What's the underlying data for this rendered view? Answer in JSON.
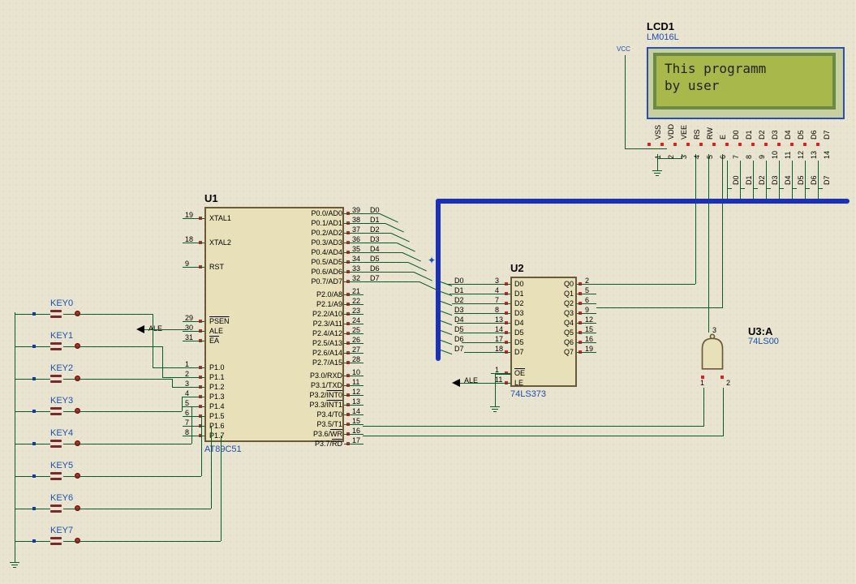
{
  "components": {
    "u1": {
      "ref": "U1",
      "part": "AT89C51",
      "pins_left": [
        {
          "name": "XTAL1",
          "num": "19"
        },
        {
          "name": "XTAL2",
          "num": "18"
        },
        {
          "name": "RST",
          "num": "9"
        },
        {
          "name": "PSEN",
          "num": "29",
          "over": true
        },
        {
          "name": "ALE",
          "num": "30"
        },
        {
          "name": "EA",
          "num": "31",
          "over": true
        },
        {
          "name": "P1.0",
          "num": "1"
        },
        {
          "name": "P1.1",
          "num": "2"
        },
        {
          "name": "P1.2",
          "num": "3"
        },
        {
          "name": "P1.3",
          "num": "4"
        },
        {
          "name": "P1.4",
          "num": "5"
        },
        {
          "name": "P1.5",
          "num": "6"
        },
        {
          "name": "P1.6",
          "num": "7"
        },
        {
          "name": "P1.7",
          "num": "8"
        }
      ],
      "pins_right": [
        {
          "name": "P0.0/AD0",
          "num": "39",
          "net": "D0"
        },
        {
          "name": "P0.1/AD1",
          "num": "38",
          "net": "D1"
        },
        {
          "name": "P0.2/AD2",
          "num": "37",
          "net": "D2"
        },
        {
          "name": "P0.3/AD3",
          "num": "36",
          "net": "D3"
        },
        {
          "name": "P0.4/AD4",
          "num": "35",
          "net": "D4"
        },
        {
          "name": "P0.5/AD5",
          "num": "34",
          "net": "D5"
        },
        {
          "name": "P0.6/AD6",
          "num": "33",
          "net": "D6"
        },
        {
          "name": "P0.7/AD7",
          "num": "32",
          "net": "D7"
        },
        {
          "name": "P2.0/A8",
          "num": "21"
        },
        {
          "name": "P2.1/A9",
          "num": "22"
        },
        {
          "name": "P2.2/A10",
          "num": "23"
        },
        {
          "name": "P2.3/A11",
          "num": "24"
        },
        {
          "name": "P2.4/A12",
          "num": "25"
        },
        {
          "name": "P2.5/A13",
          "num": "26"
        },
        {
          "name": "P2.6/A14",
          "num": "27"
        },
        {
          "name": "P2.7/A15",
          "num": "28"
        },
        {
          "name": "P3.0/RXD",
          "num": "10"
        },
        {
          "name": "P3.1/TXD",
          "num": "11"
        },
        {
          "name": "P3.2/INT0",
          "num": "12",
          "over": "INT0"
        },
        {
          "name": "P3.3/INT1",
          "num": "13",
          "over": "INT1"
        },
        {
          "name": "P3.4/T0",
          "num": "14"
        },
        {
          "name": "P3.5/T1",
          "num": "15"
        },
        {
          "name": "P3.6/WR",
          "num": "16",
          "over": "WR"
        },
        {
          "name": "P3.7/RD",
          "num": "17",
          "over": "RD"
        }
      ]
    },
    "u2": {
      "ref": "U2",
      "part": "74LS373",
      "pins_left": [
        {
          "name": "D0",
          "num": "3"
        },
        {
          "name": "D1",
          "num": "4"
        },
        {
          "name": "D2",
          "num": "7"
        },
        {
          "name": "D3",
          "num": "8"
        },
        {
          "name": "D4",
          "num": "13"
        },
        {
          "name": "D5",
          "num": "14"
        },
        {
          "name": "D5",
          "num": "17"
        },
        {
          "name": "D7",
          "num": "18"
        },
        {
          "name": "OE",
          "num": "1",
          "over": true
        },
        {
          "name": "LE",
          "num": "11"
        }
      ],
      "pins_right": [
        {
          "name": "Q0",
          "num": "2"
        },
        {
          "name": "Q1",
          "num": "5"
        },
        {
          "name": "Q2",
          "num": "6"
        },
        {
          "name": "Q3",
          "num": "9"
        },
        {
          "name": "Q4",
          "num": "12"
        },
        {
          "name": "Q5",
          "num": "15"
        },
        {
          "name": "Q6",
          "num": "16"
        },
        {
          "name": "Q7",
          "num": "19"
        }
      ]
    },
    "u3": {
      "ref": "U3:A",
      "part": "74LS00",
      "pin_out": "3",
      "pin_a": "1",
      "pin_b": "2"
    },
    "lcd1": {
      "ref": "LCD1",
      "part": "LM016L",
      "line1": "This programm",
      "line2": " by user",
      "pins": [
        "VSS",
        "VDD",
        "VEE",
        "RS",
        "RW",
        "E",
        "D0",
        "D1",
        "D2",
        "D3",
        "D4",
        "D5",
        "D6",
        "D7"
      ],
      "nums": [
        "1",
        "2",
        "3",
        "4",
        "5",
        "6",
        "7",
        "8",
        "9",
        "10",
        "11",
        "12",
        "13",
        "14"
      ]
    },
    "keys": [
      "KEY0",
      "KEY1",
      "KEY2",
      "KEY3",
      "KEY4",
      "KEY5",
      "KEY6",
      "KEY7"
    ]
  },
  "labels": {
    "vcc": "VCC",
    "ale": "ALE"
  },
  "bus_nets_lcd": [
    "D0",
    "D1",
    "D2",
    "D3",
    "D4",
    "D5",
    "D6",
    "D7"
  ]
}
